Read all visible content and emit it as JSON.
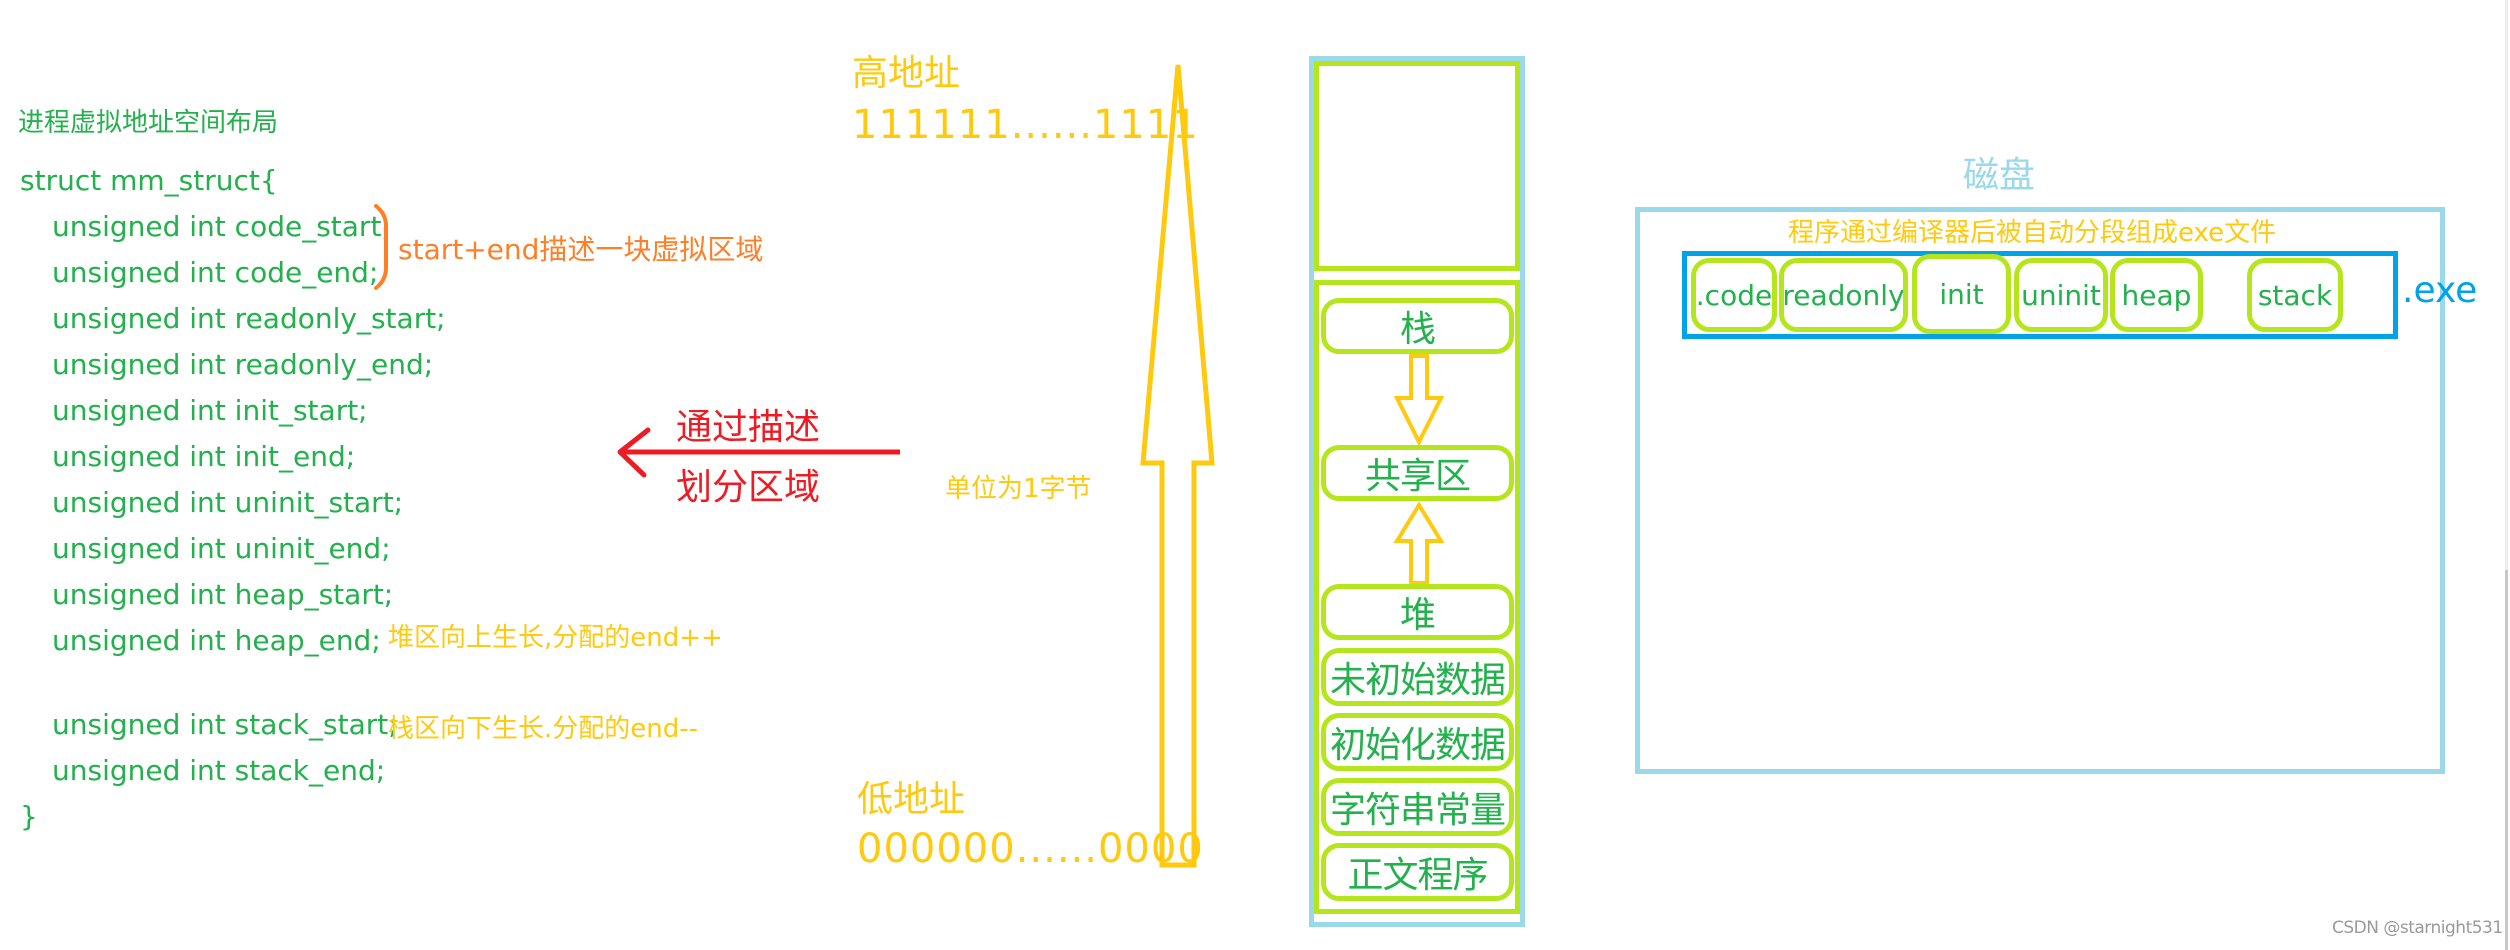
{
  "left_panel": {
    "title": "进程虚拟地址空间布局",
    "code_open": "struct mm_struct{",
    "fields": [
      "unsigned int code_start;",
      "unsigned int code_end;",
      "unsigned int readonly_start;",
      "unsigned int readonly_end;",
      "unsigned int init_start;",
      "unsigned int init_end;",
      "unsigned int uninit_start;",
      "unsigned int uninit_end;",
      "unsigned int heap_start;",
      "unsigned int heap_end;",
      "unsigned int stack_start;",
      "unsigned int stack_end;"
    ],
    "code_close": "}",
    "brace_note": "start+end描述一块虚拟区域",
    "heap_note": "堆区向上生长,分配的end++",
    "stack_note": "栈区向下生长.分配的end--"
  },
  "middle": {
    "arrow_label_top": "通过描述",
    "arrow_label_bottom": "划分区域",
    "unit_note": "单位为1字节",
    "high_address_label": "高地址",
    "high_address_bits": "111111......1111",
    "low_address_label": "低地址",
    "low_address_bits": "000000......0000"
  },
  "memory_layout": {
    "segments": {
      "stack": "栈",
      "shared": "共享区",
      "heap": "堆",
      "uninit": "未初始数据",
      "init": "初始化数据",
      "rodata": "字符串常量",
      "text": "正文程序"
    }
  },
  "disk": {
    "label": "磁盘",
    "note": "程序通过编译器后被自动分段组成exe文件",
    "exe_label": ".exe",
    "sections": [
      ".code",
      "readonly",
      "init",
      "uninit",
      "heap",
      "stack"
    ]
  },
  "watermark": "CSDN @starnight531",
  "colors": {
    "code_green": "#22b14c",
    "note_yellow": "#ffc90e",
    "note_orange": "#ff7f27",
    "arrow_red": "#ed1c24",
    "box_lime": "#b5e61d",
    "box_lightblue": "#99d9ea",
    "exe_blue": "#00a2e8"
  }
}
